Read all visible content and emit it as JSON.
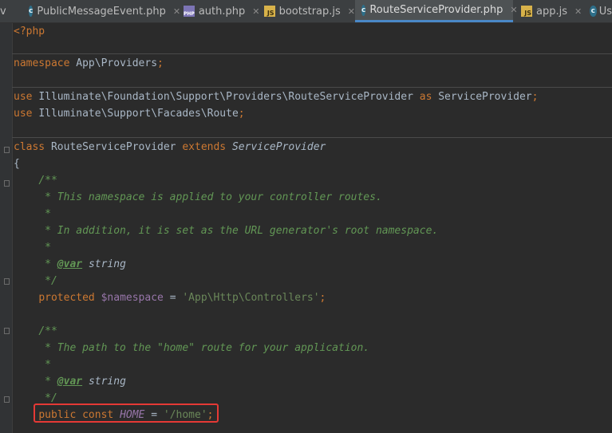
{
  "tabs": [
    {
      "label": "v",
      "icon": "",
      "active": false
    },
    {
      "label": "PublicMessageEvent.php",
      "icon": "c",
      "active": false
    },
    {
      "label": "auth.php",
      "icon": "php",
      "active": false
    },
    {
      "label": "bootstrap.js",
      "icon": "js",
      "active": false
    },
    {
      "label": "RouteServiceProvider.php",
      "icon": "c",
      "active": true
    },
    {
      "label": "app.js",
      "icon": "js",
      "active": false
    },
    {
      "label": "Us",
      "icon": "c",
      "active": false
    }
  ],
  "icon_badges": {
    "c": "c",
    "php": "PHP",
    "js": "JS"
  },
  "code": {
    "php_open": "<?php",
    "kw_namespace": "namespace",
    "namespace_name": "App\\Providers",
    "kw_use": "use",
    "use1_path": "Illuminate\\Foundation\\Support\\Providers\\RouteServiceProvider",
    "kw_as": "as",
    "use1_alias": "ServiceProvider",
    "use2_path": "Illuminate\\Support\\Facades\\Route",
    "semicolon": ";",
    "kw_class": "class",
    "class_name": "RouteServiceProvider",
    "kw_extends": "extends",
    "parent_class": "ServiceProvider",
    "brace_open": "{",
    "doc_open": "/**",
    "doc_star": "*",
    "doc_close": "*/",
    "doc1_line1": "* This namespace is applied to your controller routes.",
    "doc1_line2": "* In addition, it is set as the URL generator's root namespace.",
    "doc_var_tag": "@var",
    "doc_var_type": "string",
    "kw_protected": "protected",
    "prop_name": "$namespace",
    "assign": "=",
    "prop_value": "'App\\Http\\Controllers'",
    "doc2_line1": "* The path to the \"home\" route for your application.",
    "kw_public": "public",
    "kw_const": "const",
    "const_name": "HOME",
    "const_value": "'/home'"
  }
}
